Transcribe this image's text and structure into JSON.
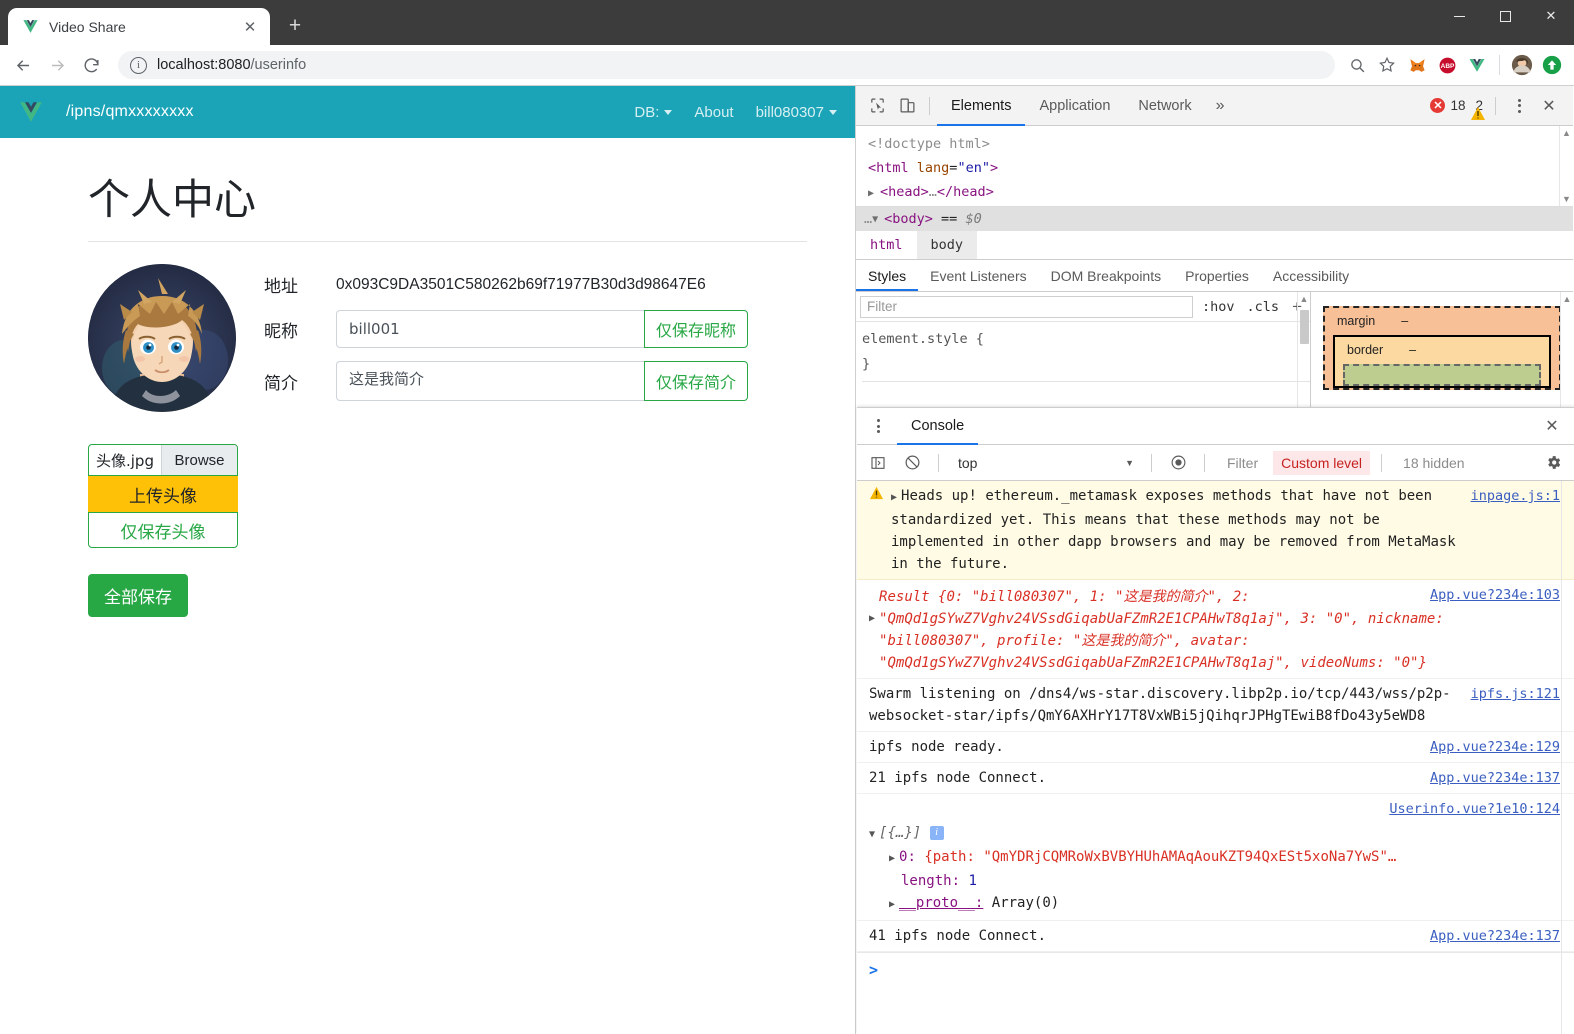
{
  "browser": {
    "tab": {
      "title": "Video Share",
      "favicon": "vue-logo-icon"
    },
    "newtab_label": "+",
    "window_controls": {
      "minimize": "–",
      "maximize": "□",
      "close": "✕"
    },
    "address": {
      "protocol_icon": "info-circle-icon",
      "host": "localhost:8080",
      "path": "/userinfo"
    },
    "toolbar_icons": [
      "zoom-search-icon",
      "bookmark-star-icon",
      "metamask-fox-icon",
      "adblock-plus-icon",
      "vue-devtools-icon",
      "profile-avatar-icon",
      "extension-upload-icon"
    ],
    "abp_label": "ABP"
  },
  "app": {
    "navbar": {
      "logo": "vue-logo-icon",
      "path": "/ipns/qmxxxxxxxx",
      "links": [
        {
          "label": "DB:",
          "has_caret": true
        },
        {
          "label": "About",
          "has_caret": false
        },
        {
          "label": "bill080307",
          "has_caret": true
        }
      ]
    },
    "page_title": "个人中心",
    "avatar_alt": "user-avatar",
    "fields": [
      {
        "label": "地址",
        "type": "static",
        "value": "0x093C9DA3501C580262b69f71977B30d3d98647E6"
      },
      {
        "label": "昵称",
        "type": "input",
        "value": "bill001",
        "button": "仅保存昵称"
      },
      {
        "label": "简介",
        "type": "textarea",
        "value": "这是我简介",
        "button": "仅保存简介"
      }
    ],
    "upload": {
      "file_name": "头像.jpg",
      "browse_label": "Browse",
      "upload_label": "上传头像",
      "save_avatar_label": "仅保存头像"
    },
    "save_all_label": "全部保存",
    "colors": {
      "navbar": "#1ba4b8",
      "primary_green": "#28a745",
      "warning_yellow": "#ffc107"
    }
  },
  "devtools": {
    "toolbar": {
      "inspect_icon": "inspect-cursor-icon",
      "device_icon": "device-toolbar-icon",
      "tabs": [
        {
          "label": "Elements",
          "active": true
        },
        {
          "label": "Application",
          "active": false
        },
        {
          "label": "Network",
          "active": false
        }
      ],
      "more_label": "»",
      "error_count": "18",
      "warning_count": "2",
      "error_mark": "✕",
      "warning_mark": "!",
      "menu_icon": "kebab-menu-icon",
      "close_icon": "close-icon"
    },
    "dom": {
      "lines": [
        {
          "indent": 0,
          "arrow": "",
          "text": "<!doctype html>",
          "kind": "doctype"
        },
        {
          "indent": 0,
          "arrow": "",
          "text": "<html lang=\"en\">",
          "kind": "tag-attr"
        },
        {
          "indent": 1,
          "arrow": "▶",
          "text": "<head>…</head>",
          "kind": "tag"
        }
      ],
      "selected_line": "<body> == $0",
      "selected_prefix": "…",
      "selected_arrow": "▼",
      "selected_dollar": "$0"
    },
    "breadcrumb": [
      {
        "label": "html",
        "selected": false
      },
      {
        "label": "body",
        "selected": true
      }
    ],
    "pane_tabs": [
      {
        "label": "Styles",
        "active": true
      },
      {
        "label": "Event Listeners",
        "active": false
      },
      {
        "label": "DOM Breakpoints",
        "active": false
      },
      {
        "label": "Properties",
        "active": false
      },
      {
        "label": "Accessibility",
        "active": false
      }
    ],
    "styles": {
      "filter_placeholder": "Filter",
      "hov_label": ":hov",
      "cls_label": ".cls",
      "plus_label": "+",
      "rule_open": "element.style {",
      "rule_close": "}"
    },
    "box_model": {
      "margin_label": "margin",
      "margin_value": "–",
      "border_label": "border",
      "border_value": "–"
    }
  },
  "console": {
    "title": "Console",
    "kebab_icon": "kebab-menu-icon",
    "close_icon": "close-icon",
    "sidebar_icon": "console-sidebar-icon",
    "clear_icon": "clear-console-icon",
    "context": "top",
    "eye_icon": "live-expression-icon",
    "filter_placeholder": "Filter",
    "custom_level": "Custom level",
    "hidden_label": "18 hidden",
    "settings_icon": "gear-icon",
    "prompt": ">",
    "messages": [
      {
        "type": "warning",
        "icon": "warning-triangle-icon",
        "expand": "▶",
        "text": "Heads up! ethereum._metamask exposes methods that have not been standardized yet. This means that these methods may not be implemented in other dapp browsers and may be removed from MetaMask in the future.",
        "source": "inpage.js:1"
      },
      {
        "type": "object",
        "expand": "▶",
        "prefix": "Result {",
        "source": "App.vue?234e:103",
        "body": "Result {0: \"bill080307\", 1: \"这是我的简介\", 2: \"QmQd1gSYwZ7Vghv24VSsdGiqabUaFZmR2E1CPAHwT8q1aj\", 3: \"0\", nickname: \"bill080307\", profile: \"这是我的简介\", avatar: \"QmQd1gSYwZ7Vghv24VSsdGiqabUaFZmR2E1CPAHwT8q1aj\", videoNums: \"0\"}"
      },
      {
        "type": "log",
        "text": "Swarm listening on /dns4/ws-star.discovery.libp2p.io/tcp/443/wss/p2p-websocket-star/ipfs/QmY6AXHrY17T8VxWBi5jQihqrJPHgTEwiB8fDo43y5eWD8",
        "source": "ipfs.js:121"
      },
      {
        "type": "log",
        "text": "ipfs node ready.",
        "source": "App.vue?234e:129"
      },
      {
        "type": "log",
        "text": "21 ipfs node Connect.",
        "source": "App.vue?234e:137"
      },
      {
        "type": "array",
        "source": "Userinfo.vue?1e10:124",
        "header_arrow": "▼",
        "header": "[{…}]",
        "info_badge": "i",
        "rows": [
          {
            "arrow": "▶",
            "key": "0:",
            "value": "{path: \"QmYDRjCQMRoWxBVBYHUhAMAqAouKZT94QxESt5xoNa7YwS\"…"
          },
          {
            "arrow": "",
            "key": "length:",
            "value": "1"
          },
          {
            "arrow": "▶",
            "key": "__proto__:",
            "value": "Array(0)"
          }
        ]
      },
      {
        "type": "log",
        "text": "41 ipfs node Connect.",
        "source": "App.vue?234e:137"
      }
    ]
  }
}
